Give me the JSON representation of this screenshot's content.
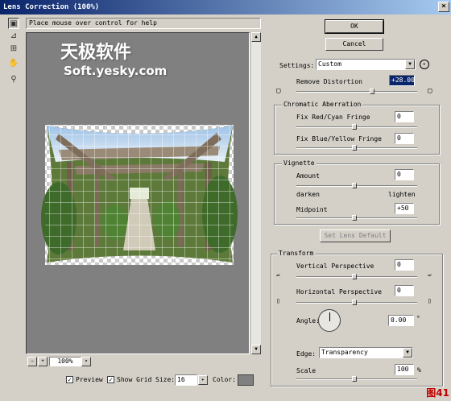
{
  "window": {
    "title": "Lens Correction (100%)",
    "close_label": "×"
  },
  "help_text": "Place mouse over control for help",
  "watermark": {
    "text_cn": "天极软件",
    "text_url": "Soft.yesky.com"
  },
  "tools": [
    "remove-distortion-tool",
    "straighten-tool",
    "move-grid-tool",
    "hand-tool",
    "zoom-tool"
  ],
  "zoom": {
    "value": "100%",
    "minus": "−",
    "plus": "+",
    "arrow": "▾"
  },
  "bottom_options": {
    "preview_label": "Preview",
    "preview_checked": "✓",
    "show_grid_label": "Show Grid",
    "show_grid_checked": "✓",
    "size_label": "Size:",
    "size_value": "16",
    "color_label": "Color:",
    "color_swatch": "#808080"
  },
  "buttons": {
    "ok": "OK",
    "cancel": "Cancel",
    "set_lens_default": "Set Lens Default"
  },
  "settings": {
    "label": "Settings:",
    "value": "Custom"
  },
  "remove_distortion": {
    "label": "Remove Distortion",
    "value": "+28.00"
  },
  "chromatic": {
    "title": "Chromatic Aberration",
    "red_cyan_label": "Fix Red/Cyan Fringe",
    "red_cyan_value": "0",
    "blue_yellow_label": "Fix Blue/Yellow Fringe",
    "blue_yellow_value": "0"
  },
  "vignette": {
    "title": "Vignette",
    "amount_label": "Amount",
    "amount_value": "0",
    "darken_label": "darken",
    "lighten_label": "lighten",
    "midpoint_label": "Midpoint",
    "midpoint_value": "+50"
  },
  "transform": {
    "title": "Transform",
    "vertical_label": "Vertical Perspective",
    "vertical_value": "0",
    "horizontal_label": "Horizontal Perspective",
    "horizontal_value": "0",
    "angle_label": "Angle:",
    "angle_value": "0.00",
    "angle_unit": "°",
    "edge_label": "Edge:",
    "edge_value": "Transparency",
    "scale_label": "Scale",
    "scale_value": "100",
    "scale_unit": "%"
  },
  "figure_label": "图41",
  "colors": {
    "title_bar": "#0a246a",
    "dialog": "#d4d0c8",
    "canvas": "#808080",
    "figure_label": "#c00000"
  }
}
